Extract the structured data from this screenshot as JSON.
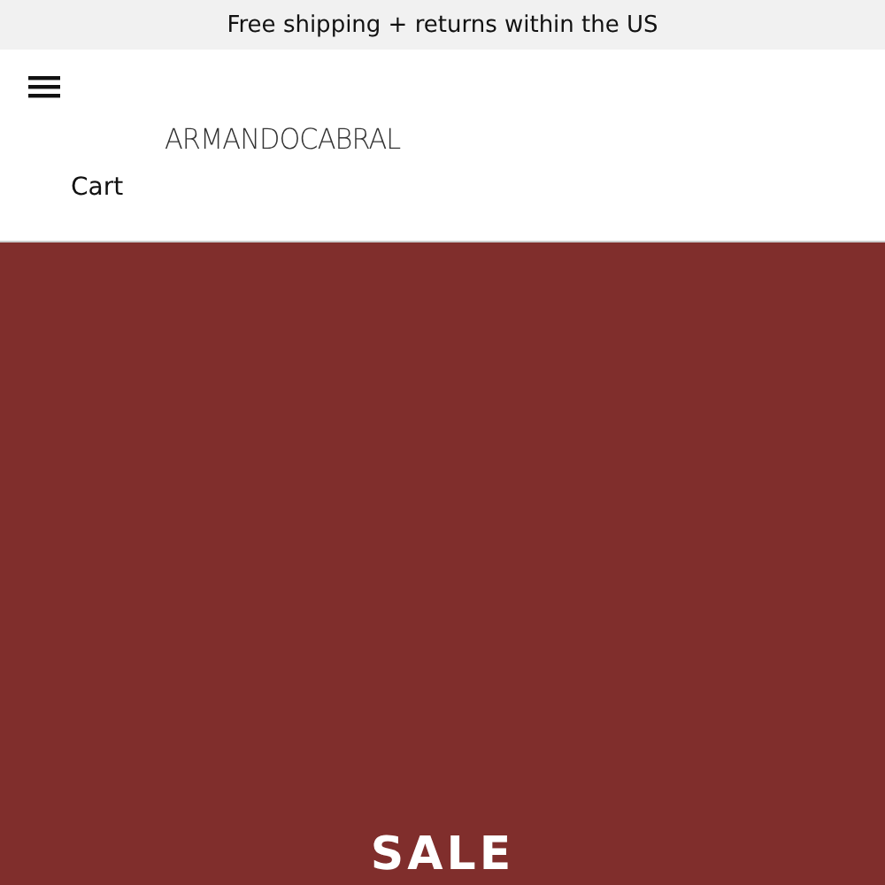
{
  "announcement": "Free shipping + returns within the US",
  "header": {
    "logo": "ARMANDOCABRAL",
    "cart": "Cart"
  },
  "hero": {
    "title": "SALE"
  }
}
